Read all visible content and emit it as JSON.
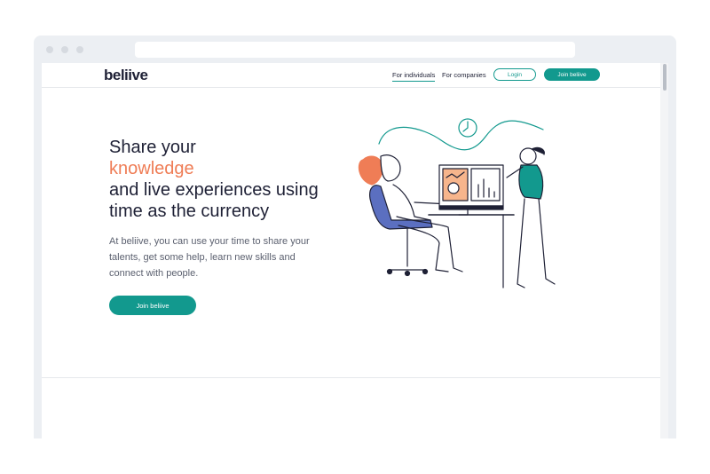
{
  "nav": {
    "logo": "beliive",
    "links": [
      {
        "label": "For individuals",
        "active": true
      },
      {
        "label": "For companies",
        "active": false
      }
    ],
    "login_label": "Login",
    "join_label": "Join beliive"
  },
  "hero": {
    "headline_line1": "Share your",
    "headline_accent": "knowledge",
    "headline_line3": "and live experiences using",
    "headline_line4": "time as the currency",
    "description": "At beliive, you can use your time to share your talents, get some help, learn new skills and connect with people.",
    "cta_label": "Join beliive"
  },
  "colors": {
    "brand": "#12998e",
    "accent": "#ef7d56",
    "text": "#1e2035"
  },
  "icons": [
    "clock-icon",
    "monitor-icon",
    "chair-icon"
  ]
}
